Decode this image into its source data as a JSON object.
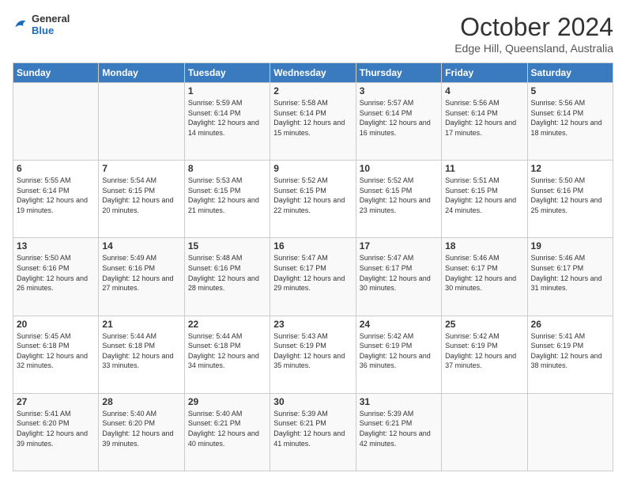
{
  "header": {
    "logo_general": "General",
    "logo_blue": "Blue",
    "month_title": "October 2024",
    "location": "Edge Hill, Queensland, Australia"
  },
  "days_of_week": [
    "Sunday",
    "Monday",
    "Tuesday",
    "Wednesday",
    "Thursday",
    "Friday",
    "Saturday"
  ],
  "weeks": [
    [
      {
        "day": "",
        "info": ""
      },
      {
        "day": "",
        "info": ""
      },
      {
        "day": "1",
        "info": "Sunrise: 5:59 AM\nSunset: 6:14 PM\nDaylight: 12 hours and 14 minutes."
      },
      {
        "day": "2",
        "info": "Sunrise: 5:58 AM\nSunset: 6:14 PM\nDaylight: 12 hours and 15 minutes."
      },
      {
        "day": "3",
        "info": "Sunrise: 5:57 AM\nSunset: 6:14 PM\nDaylight: 12 hours and 16 minutes."
      },
      {
        "day": "4",
        "info": "Sunrise: 5:56 AM\nSunset: 6:14 PM\nDaylight: 12 hours and 17 minutes."
      },
      {
        "day": "5",
        "info": "Sunrise: 5:56 AM\nSunset: 6:14 PM\nDaylight: 12 hours and 18 minutes."
      }
    ],
    [
      {
        "day": "6",
        "info": "Sunrise: 5:55 AM\nSunset: 6:14 PM\nDaylight: 12 hours and 19 minutes."
      },
      {
        "day": "7",
        "info": "Sunrise: 5:54 AM\nSunset: 6:15 PM\nDaylight: 12 hours and 20 minutes."
      },
      {
        "day": "8",
        "info": "Sunrise: 5:53 AM\nSunset: 6:15 PM\nDaylight: 12 hours and 21 minutes."
      },
      {
        "day": "9",
        "info": "Sunrise: 5:52 AM\nSunset: 6:15 PM\nDaylight: 12 hours and 22 minutes."
      },
      {
        "day": "10",
        "info": "Sunrise: 5:52 AM\nSunset: 6:15 PM\nDaylight: 12 hours and 23 minutes."
      },
      {
        "day": "11",
        "info": "Sunrise: 5:51 AM\nSunset: 6:15 PM\nDaylight: 12 hours and 24 minutes."
      },
      {
        "day": "12",
        "info": "Sunrise: 5:50 AM\nSunset: 6:16 PM\nDaylight: 12 hours and 25 minutes."
      }
    ],
    [
      {
        "day": "13",
        "info": "Sunrise: 5:50 AM\nSunset: 6:16 PM\nDaylight: 12 hours and 26 minutes."
      },
      {
        "day": "14",
        "info": "Sunrise: 5:49 AM\nSunset: 6:16 PM\nDaylight: 12 hours and 27 minutes."
      },
      {
        "day": "15",
        "info": "Sunrise: 5:48 AM\nSunset: 6:16 PM\nDaylight: 12 hours and 28 minutes."
      },
      {
        "day": "16",
        "info": "Sunrise: 5:47 AM\nSunset: 6:17 PM\nDaylight: 12 hours and 29 minutes."
      },
      {
        "day": "17",
        "info": "Sunrise: 5:47 AM\nSunset: 6:17 PM\nDaylight: 12 hours and 30 minutes."
      },
      {
        "day": "18",
        "info": "Sunrise: 5:46 AM\nSunset: 6:17 PM\nDaylight: 12 hours and 30 minutes."
      },
      {
        "day": "19",
        "info": "Sunrise: 5:46 AM\nSunset: 6:17 PM\nDaylight: 12 hours and 31 minutes."
      }
    ],
    [
      {
        "day": "20",
        "info": "Sunrise: 5:45 AM\nSunset: 6:18 PM\nDaylight: 12 hours and 32 minutes."
      },
      {
        "day": "21",
        "info": "Sunrise: 5:44 AM\nSunset: 6:18 PM\nDaylight: 12 hours and 33 minutes."
      },
      {
        "day": "22",
        "info": "Sunrise: 5:44 AM\nSunset: 6:18 PM\nDaylight: 12 hours and 34 minutes."
      },
      {
        "day": "23",
        "info": "Sunrise: 5:43 AM\nSunset: 6:19 PM\nDaylight: 12 hours and 35 minutes."
      },
      {
        "day": "24",
        "info": "Sunrise: 5:42 AM\nSunset: 6:19 PM\nDaylight: 12 hours and 36 minutes."
      },
      {
        "day": "25",
        "info": "Sunrise: 5:42 AM\nSunset: 6:19 PM\nDaylight: 12 hours and 37 minutes."
      },
      {
        "day": "26",
        "info": "Sunrise: 5:41 AM\nSunset: 6:19 PM\nDaylight: 12 hours and 38 minutes."
      }
    ],
    [
      {
        "day": "27",
        "info": "Sunrise: 5:41 AM\nSunset: 6:20 PM\nDaylight: 12 hours and 39 minutes."
      },
      {
        "day": "28",
        "info": "Sunrise: 5:40 AM\nSunset: 6:20 PM\nDaylight: 12 hours and 39 minutes."
      },
      {
        "day": "29",
        "info": "Sunrise: 5:40 AM\nSunset: 6:21 PM\nDaylight: 12 hours and 40 minutes."
      },
      {
        "day": "30",
        "info": "Sunrise: 5:39 AM\nSunset: 6:21 PM\nDaylight: 12 hours and 41 minutes."
      },
      {
        "day": "31",
        "info": "Sunrise: 5:39 AM\nSunset: 6:21 PM\nDaylight: 12 hours and 42 minutes."
      },
      {
        "day": "",
        "info": ""
      },
      {
        "day": "",
        "info": ""
      }
    ]
  ]
}
